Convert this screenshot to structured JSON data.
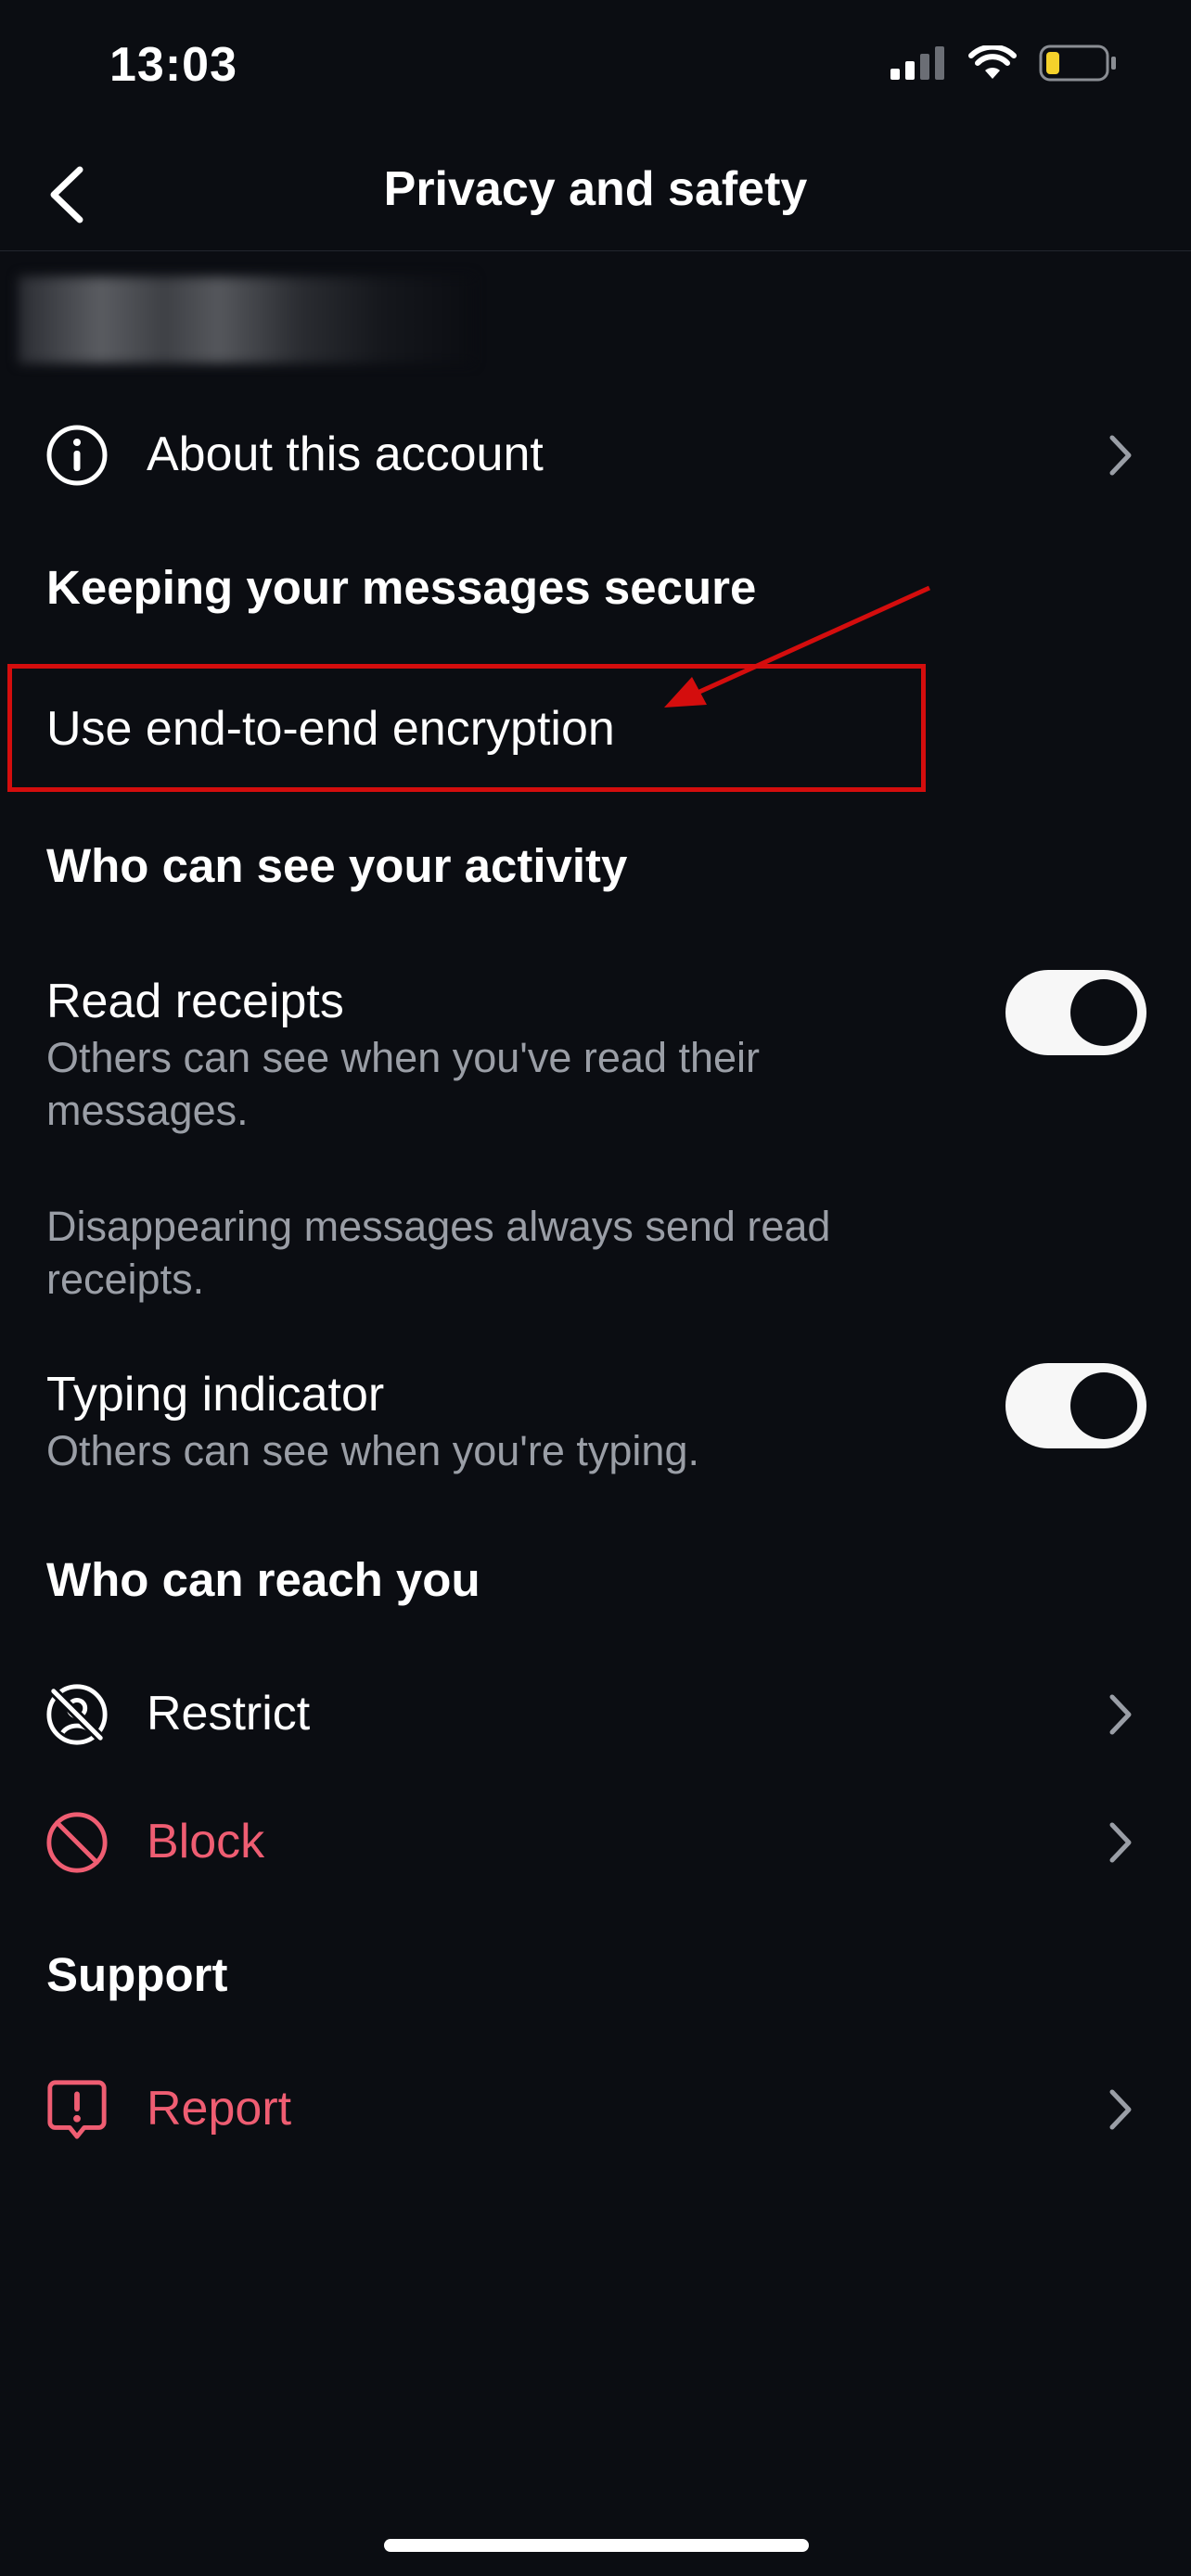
{
  "status_bar": {
    "time": "13:03",
    "battery_level": 0.2
  },
  "nav": {
    "title": "Privacy and safety"
  },
  "rows": {
    "about": {
      "label": "About this account",
      "icon": "info-icon"
    },
    "restrict": {
      "label": "Restrict",
      "icon": "restrict-icon"
    },
    "block": {
      "label": "Block",
      "icon": "block-icon"
    },
    "report": {
      "label": "Report",
      "icon": "report-icon"
    }
  },
  "sections": {
    "messages_secure": "Keeping your messages secure",
    "activity": "Who can see your activity",
    "reach": "Who can reach you",
    "support": "Support"
  },
  "encryption": {
    "label": "Use end-to-end encryption"
  },
  "read_receipts": {
    "label": "Read receipts",
    "description": "Others can see when you've read their messages.",
    "enabled": true
  },
  "disappearing_note": "Disappearing messages always send read receipts.",
  "typing_indicator": {
    "label": "Typing indicator",
    "description": "Others can see when you're typing.",
    "enabled": true
  },
  "colors": {
    "background": "#0b0d12",
    "destructive": "#ef5d72",
    "annotation": "#d40d0d",
    "battery": "#f5d12b"
  }
}
